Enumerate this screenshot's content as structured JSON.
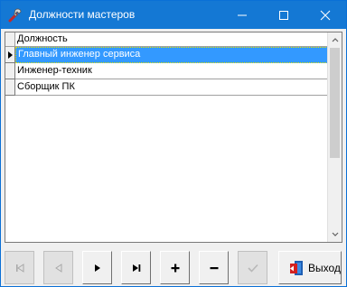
{
  "window": {
    "title": "Должности мастеров",
    "title_icon": "tools-icon"
  },
  "grid": {
    "columns": [
      "Должность"
    ],
    "rows": [
      {
        "label": "Главный инженер сервиса",
        "selected": true
      },
      {
        "label": "Инженер-техник",
        "selected": false
      },
      {
        "label": "Сборщик ПК",
        "selected": false
      }
    ]
  },
  "navigator": {
    "buttons": [
      {
        "name": "first-record",
        "icon": "skip-first-icon",
        "enabled": false
      },
      {
        "name": "prior-record",
        "icon": "play-left-icon",
        "enabled": false
      },
      {
        "name": "next-record",
        "icon": "play-right-icon",
        "enabled": true
      },
      {
        "name": "last-record",
        "icon": "skip-last-icon",
        "enabled": true
      },
      {
        "name": "insert-record",
        "icon": "plus-icon",
        "enabled": true
      },
      {
        "name": "delete-record",
        "icon": "minus-icon",
        "enabled": true
      },
      {
        "name": "post-record",
        "icon": "checkmark-icon",
        "enabled": false
      }
    ]
  },
  "exit_button": {
    "label": "Выход",
    "icon": "exit-door-icon"
  },
  "colors": {
    "titlebar": "#1478d4",
    "selection": "#3399ff"
  }
}
